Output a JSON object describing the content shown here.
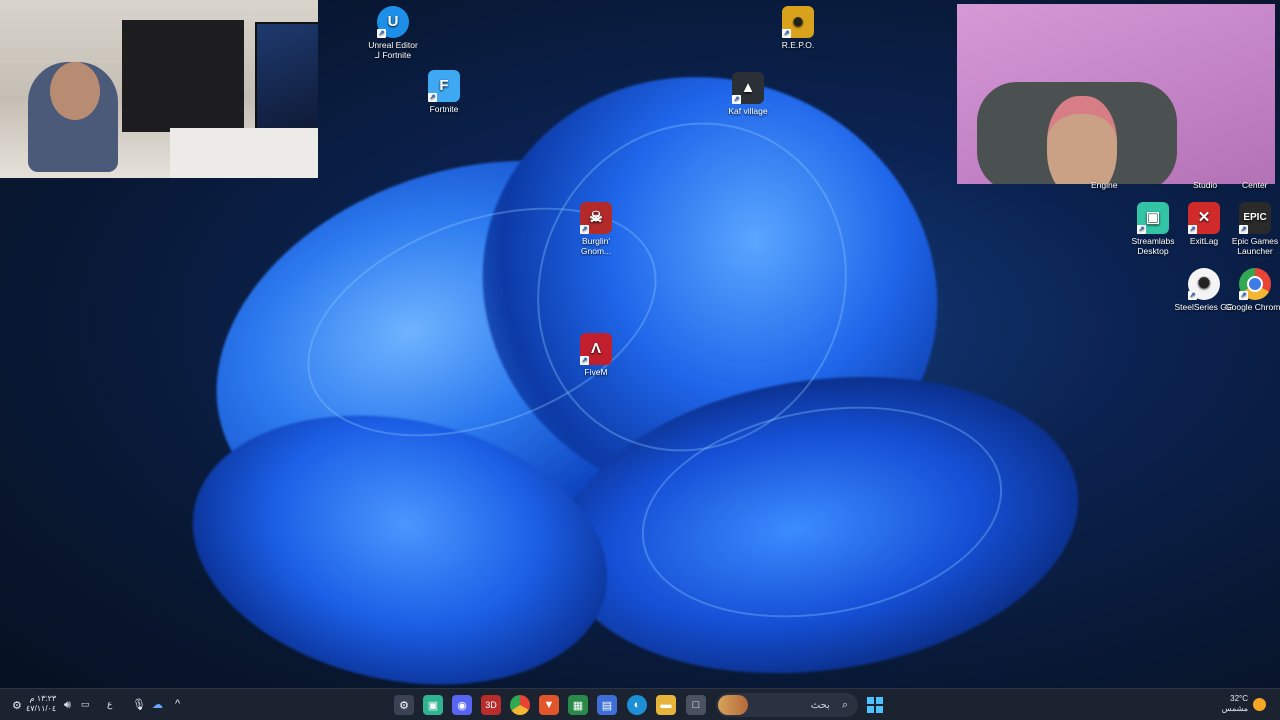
{
  "desktop": {
    "icons": [
      {
        "label": "Unreal Editor\nلـ Fortnite",
        "icon": "unreal-icon",
        "color": "#1e8fe8"
      },
      {
        "label": "Fortnite",
        "icon": "fortnite-icon",
        "color": "#3fa8f2"
      },
      {
        "label": "R.E.P.O.",
        "icon": "repo-icon",
        "color": "#d8a21c"
      },
      {
        "label": "Kaf village",
        "icon": "kaf-village-icon",
        "color": "#2b2f36"
      },
      {
        "label": "Burglin' Gnom...",
        "icon": "burglin-gnomes-icon",
        "color": "#b22a2a"
      },
      {
        "label": "FiveM",
        "icon": "fivem-icon",
        "color": "#c21f2e"
      },
      {
        "label": "Streamlabs Desktop",
        "icon": "streamlabs-icon",
        "color": "#33c3a5"
      },
      {
        "label": "ExitLag",
        "icon": "exitlag-icon",
        "color": "#d12a2a"
      },
      {
        "label": "Epic Games Launcher",
        "icon": "epic-games-icon",
        "color": "#2a2a2a"
      },
      {
        "label": "SteelSeries GG",
        "icon": "steelseries-icon",
        "color": "#f4f4f4"
      },
      {
        "label": "Google Chrome",
        "icon": "chrome-icon",
        "color": "#f2b632"
      }
    ],
    "partial_labels": [
      "Engine",
      "Studio",
      "Center"
    ]
  },
  "taskbar": {
    "search_placeholder": "بحث",
    "apps": [
      {
        "name": "settings-icon",
        "glyph": "⚙",
        "color": "#3a4254"
      },
      {
        "name": "streamlabs-icon",
        "glyph": "▣",
        "color": "#2fb390"
      },
      {
        "name": "discord-icon",
        "glyph": "◉",
        "color": "#5865f2"
      },
      {
        "name": "3d-app-icon",
        "glyph": "3D",
        "color": "#b82c2c"
      },
      {
        "name": "chrome-icon",
        "glyph": "◎",
        "color": "#d9a321"
      },
      {
        "name": "brave-icon",
        "glyph": "▼",
        "color": "#e0562a"
      },
      {
        "name": "app-icon",
        "glyph": "▦",
        "color": "#2a8a4a"
      },
      {
        "name": "store-icon",
        "glyph": "▤",
        "color": "#3d6fd6"
      },
      {
        "name": "edge-icon",
        "glyph": "◐",
        "color": "#1d8fd6"
      },
      {
        "name": "file-explorer-icon",
        "glyph": "▬",
        "color": "#e6b43a"
      },
      {
        "name": "window-icon",
        "glyph": "□",
        "color": "#4a5262"
      }
    ],
    "clock_time": "١٣:٢٣ م",
    "clock_date": "٤٧/١١/٠٤",
    "language": "ع",
    "weather_temp": "32°C",
    "weather_text": "مشمس"
  }
}
